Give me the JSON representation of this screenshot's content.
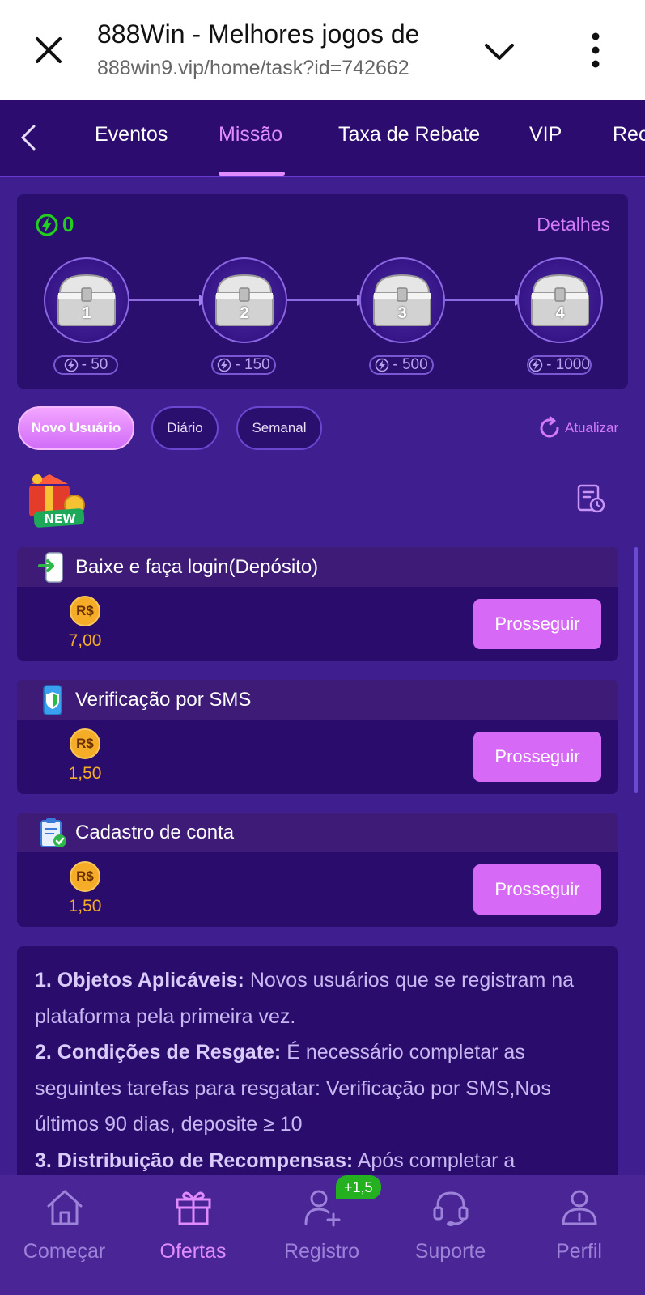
{
  "browser": {
    "title": "888Win - Melhores jogos de",
    "url": "888win9.vip/home/task?id=742662"
  },
  "tabs": [
    {
      "label": "Eventos",
      "active": false
    },
    {
      "label": "Missão",
      "active": true
    },
    {
      "label": "Taxa de Rebate",
      "active": false
    },
    {
      "label": "VIP",
      "active": false
    },
    {
      "label": "Rec",
      "active": false
    }
  ],
  "progress": {
    "energy_value": "0",
    "details_label": "Detalhes",
    "chests": [
      {
        "number": "1",
        "cost": "- 50"
      },
      {
        "number": "2",
        "cost": "- 150"
      },
      {
        "number": "3",
        "cost": "- 500"
      },
      {
        "number": "4",
        "cost": "- 1000"
      }
    ]
  },
  "filters": {
    "items": [
      "Novo Usuário",
      "Diário",
      "Semanal"
    ],
    "active": "Novo Usuário",
    "refresh_label": "Atualizar"
  },
  "new_badge_text": "NEW",
  "tasks": [
    {
      "title": "Baixe e faça login(Depósito)",
      "currency": "R$",
      "reward": "7,00",
      "button": "Prosseguir",
      "icon": "phone-login-icon"
    },
    {
      "title": "Verificação por SMS",
      "currency": "R$",
      "reward": "1,50",
      "button": "Prosseguir",
      "icon": "phone-shield-icon"
    },
    {
      "title": "Cadastro de conta",
      "currency": "R$",
      "reward": "1,50",
      "button": "Prosseguir",
      "icon": "clipboard-check-icon"
    }
  ],
  "rules": {
    "r1_head": "1. Objetos Aplicáveis:",
    "r1_text": " Novos usuários que se registram na plataforma pela primeira vez.",
    "r2_head": "2. Condições de Resgate:",
    "r2_text": " É necessário completar as seguintes tarefas para resgatar: Verificação por SMS,Nos últimos 90 dias, deposite ≥ 10",
    "r3_head": "3. Distribuição de Recompensas:",
    "r3_text": " Após completar a"
  },
  "bottom_nav": [
    {
      "label": "Começar",
      "icon": "home-icon",
      "active": false
    },
    {
      "label": "Ofertas",
      "icon": "gift-icon",
      "active": true
    },
    {
      "label": "Registro",
      "icon": "add-user-icon",
      "active": false
    },
    {
      "label": "Suporte",
      "icon": "headset-icon",
      "active": false
    },
    {
      "label": "Perfil",
      "icon": "profile-icon",
      "active": false
    }
  ],
  "register_badge": "+1,5",
  "colors": {
    "background": "#3f1f8f",
    "panel": "#2a0c6c",
    "accent": "#e08cff",
    "button": "#d669f5",
    "energy": "#22d01f",
    "reward": "#f5ad28"
  }
}
